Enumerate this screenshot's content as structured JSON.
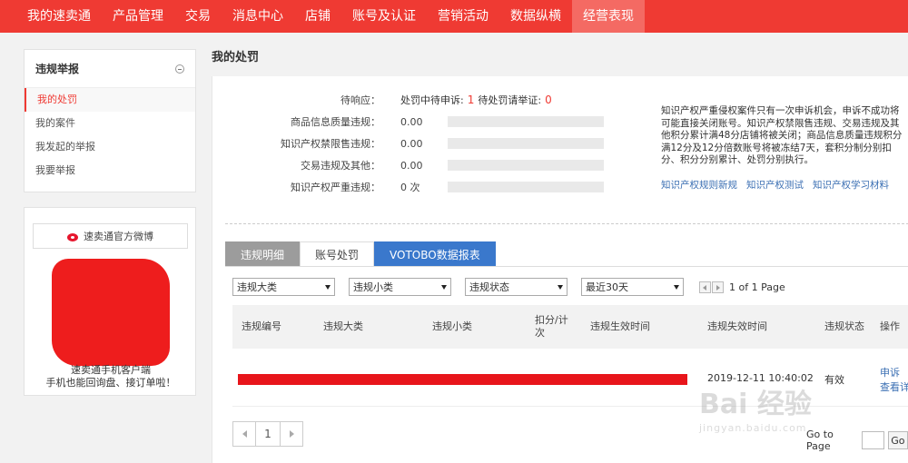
{
  "nav": {
    "items": [
      "我的速卖通",
      "产品管理",
      "交易",
      "消息中心",
      "店铺",
      "账号及认证",
      "营销活动",
      "数据纵横",
      "经营表现"
    ],
    "active_index": 8,
    "colors": {
      "bar": "#ef3a33",
      "active": "#f46a63"
    }
  },
  "sidebar": {
    "title": "违规举报",
    "collapse_icon": "collapse-circle-icon",
    "items": [
      "我的处罚",
      "我的案件",
      "我发起的举报",
      "我要举报"
    ],
    "active_index": 0
  },
  "weibo": {
    "button_label": "速卖通官方微博",
    "icon": "weibo-icon",
    "caption_line1": "速卖通手机客户端",
    "caption_line2": "手机也能回询盘、接订单啦！"
  },
  "page": {
    "title": "我的处罚"
  },
  "stats": {
    "pending_label": "待响应：",
    "pending_text1": "处罚中待申诉:",
    "pending_count1": "1",
    "pending_text2": "待处罚请举证:",
    "pending_count2": "0",
    "rows": [
      {
        "label": "商品信息质量违规：",
        "value": "0.00"
      },
      {
        "label": "知识产权禁限售违规：",
        "value": "0.00"
      },
      {
        "label": "交易违规及其他：",
        "value": "0.00"
      },
      {
        "label": "知识产权严重违规：",
        "value": "0 次"
      }
    ]
  },
  "notice": {
    "text": "知识产权严重侵权案件只有一次申诉机会，申诉不成功将可能直接关闭账号。知识产权禁限售违规、交易违规及其他积分累计满48分店铺将被关闭；商品信息质量违规积分满12分及12分倍数账号将被冻结7天，套积分制分别扣分、积分分别累计、处罚分别执行。",
    "links": [
      "知识产权规则新规",
      "知识产权测试",
      "知识产权学习材料"
    ]
  },
  "tabs": [
    "违规明细",
    "账号处罚",
    "VOTOBO数据报表"
  ],
  "filters": {
    "selects": [
      "违规大类",
      "违规小类",
      "违规状态",
      "最近30天"
    ],
    "page_info": "1 of 1 Page"
  },
  "table": {
    "headers": [
      "违规编号",
      "违规大类",
      "违规小类",
      "扣分/计次",
      "违规生效时间",
      "违规失效时间",
      "违规状态",
      "操作"
    ],
    "rows": [
      {
        "expire_time": "2019-12-11 10:40:02",
        "status": "有效",
        "op1": "申诉",
        "op2": "查看详情"
      }
    ]
  },
  "pager": {
    "current": "1",
    "goto_label": "Go to Page",
    "go_button": "Go"
  },
  "watermark": {
    "text": "Bai 经验",
    "url": "jingyan.baidu.com"
  }
}
